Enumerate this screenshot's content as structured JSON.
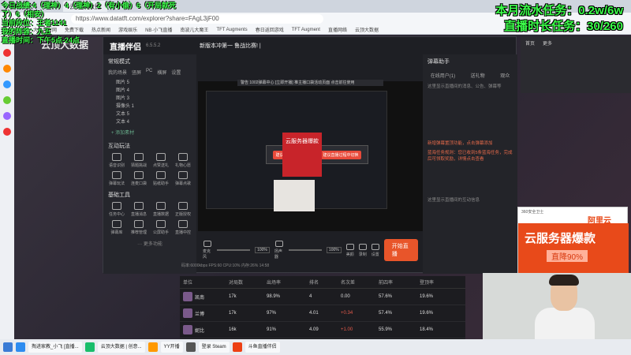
{
  "overlay_left": {
    "line1": "今日战绩:4（理神）4（理神）2（有小偷）6（开局就死了）6（相安）",
    "line2": "当前段位：王者1141",
    "line3": "我的阵容：九五",
    "line4": "直播时间：下午5点-24点"
  },
  "overlay_right": {
    "flow_task": "本月流水任务：0.2w/6w",
    "time_task": "直播时长任务：30/260"
  },
  "browser": {
    "url": "https://www.datatft.com/explorer?share=FAgL3jF00",
    "bookmarks": [
      "百度",
      "大白菜官网",
      "免费下载",
      "热点新闻",
      "游戏娱乐",
      "NB·小飞直播",
      "南波儿大魔王",
      "TFT Augments",
      "春日返回游戏",
      "TFT Augment",
      "直播网络",
      "云顶大数据"
    ]
  },
  "brand": "云顶大数据",
  "app": {
    "name": "直播伴侣",
    "version": "6.5.5.2",
    "mode": "常规模式",
    "scene_tabs": [
      "我的场景",
      "竖屏",
      "PC",
      "横屏",
      "设置"
    ],
    "sources": [
      "图片 5",
      "图片 4",
      "图片 3",
      "摄像头 1",
      "文本 5",
      "文本 4"
    ],
    "add_material": "+ 添加素材",
    "section_interactive": "互动玩法",
    "interactive": [
      "语音识别",
      "猜题挑战",
      "点赞送礼",
      "礼物心愿",
      "弹幕玩法",
      "连麦口袋",
      "贴纸助手",
      "弹幕点歌"
    ],
    "section_basic": "基础工具",
    "basic": [
      "任务中心",
      "直播消息",
      "直播数据",
      "正版授权",
      "弹幕库",
      "推荐管理",
      "公屏助手",
      "直播中控"
    ],
    "more": "··· 更多功能",
    "live_title": "新版本冲第一 鲁战比赛! | ",
    "top_notice": "警告 1002弹幕中心 [立即开播]    推主播口袋活动页面 点击前往使用",
    "modal_left": "建议本手游调整好推流",
    "modal_right": "建议直播过程中切换",
    "ad_box": "云服务器爆款",
    "controls": {
      "mic": "麦克风",
      "speaker": "扬声器",
      "mic_pct": "100%",
      "spk_pct": "100%",
      "beauty": "美颜",
      "record": "录制",
      "settings": "设置",
      "start": "开始直播"
    },
    "status": "码率:6000kbps   FPS:60   CPU:10%   内存:26%   14:58",
    "right_panel": {
      "title": "弹幕助手",
      "tabs": [
        "在线用户(1)",
        "送礼物",
        "观众"
      ],
      "text1": "这里显示直播间的消息、公告、弹幕等",
      "notice": "新增弹幕置顶功能，点击弹幕添加",
      "notice2": "蓝海任务规则：您已收到5条蓝海任务，完成后可领取奖励，详情点击查看",
      "footer": "这里显示直播间的互动信息"
    }
  },
  "right_window": {
    "tabs": [
      "首页",
      "更多"
    ]
  },
  "ad_right": {
    "label": "360安全卫士",
    "brand": "阿里云",
    "main": "云服务器爆款",
    "sub": "直降90%"
  },
  "table": {
    "headers": [
      "单位",
      "对局数",
      "出场率",
      "排名",
      "名次差",
      "前四率",
      "登顶率"
    ],
    "rows": [
      {
        "name": "凯南",
        "games": "17k",
        "pick": "98.9%",
        "rank": "4",
        "diff": "0.00",
        "top4": "57.6%",
        "win": "19.6%"
      },
      {
        "name": "兰博",
        "games": "17k",
        "pick": "97%",
        "rank": "4.01",
        "diff": "+0.34",
        "top4": "57.4%",
        "win": "19.6%"
      },
      {
        "name": "妮比",
        "games": "16k",
        "pick": "91%",
        "rank": "4.09",
        "diff": "+1.00",
        "top4": "55.9%",
        "win": "18.4%"
      }
    ]
  },
  "taskbar": {
    "items": [
      "掏进家教_小飞 [直播...",
      "云顶大数据 | 创意...",
      "YY开播",
      "登录 Steam",
      "斗鱼直播伴侣"
    ]
  }
}
